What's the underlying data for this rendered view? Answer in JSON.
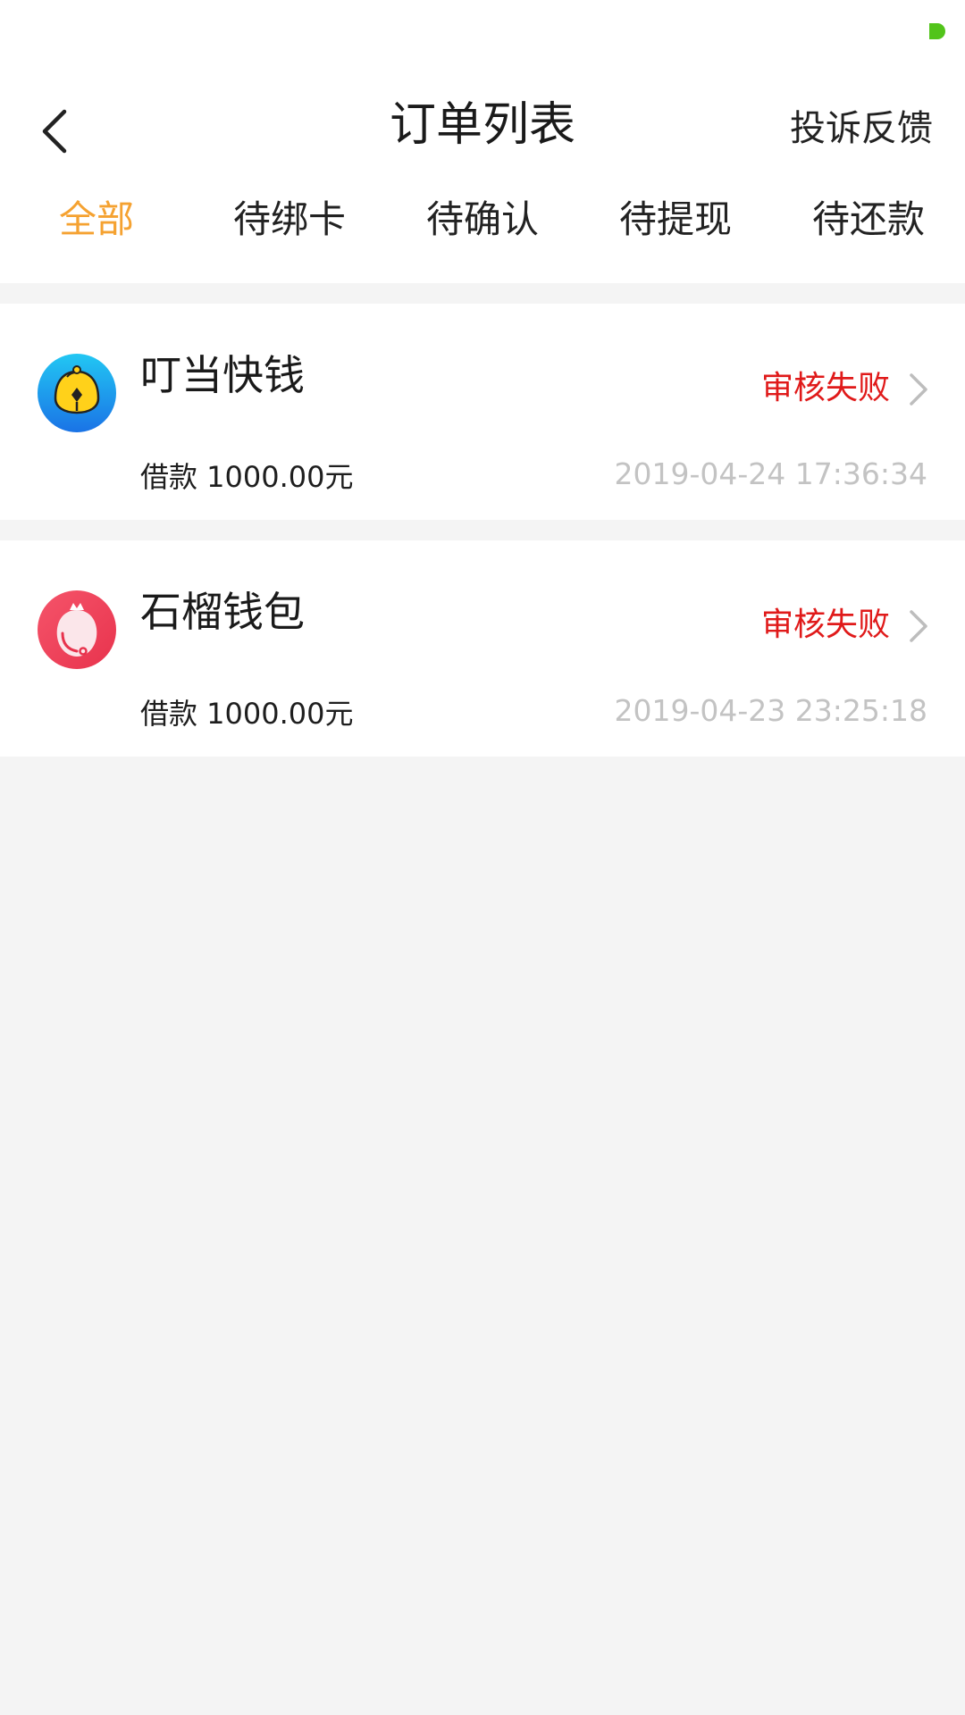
{
  "header": {
    "title": "订单列表",
    "feedback_label": "投诉反馈",
    "back_icon": "chevron-left-icon"
  },
  "tabs": [
    {
      "label": "全部",
      "active": true
    },
    {
      "label": "待绑卡",
      "active": false
    },
    {
      "label": "待确认",
      "active": false
    },
    {
      "label": "待提现",
      "active": false
    },
    {
      "label": "待还款",
      "active": false
    }
  ],
  "orders": [
    {
      "app_name": "叮当快钱",
      "amount": "借款 1000.00元",
      "status": "审核失败",
      "time": "2019-04-24 17:36:34",
      "logo_icon": "bell-logo-icon"
    },
    {
      "app_name": "石榴钱包",
      "amount": "借款 1000.00元",
      "status": "审核失败",
      "time": "2019-04-23 23:25:18",
      "logo_icon": "pomegranate-logo-icon"
    }
  ],
  "colors": {
    "accent": "#f5a231",
    "status_fail": "#e01a1a",
    "timestamp": "#c3c3c3",
    "background": "#f4f4f4",
    "status_dot": "#52c41a"
  }
}
